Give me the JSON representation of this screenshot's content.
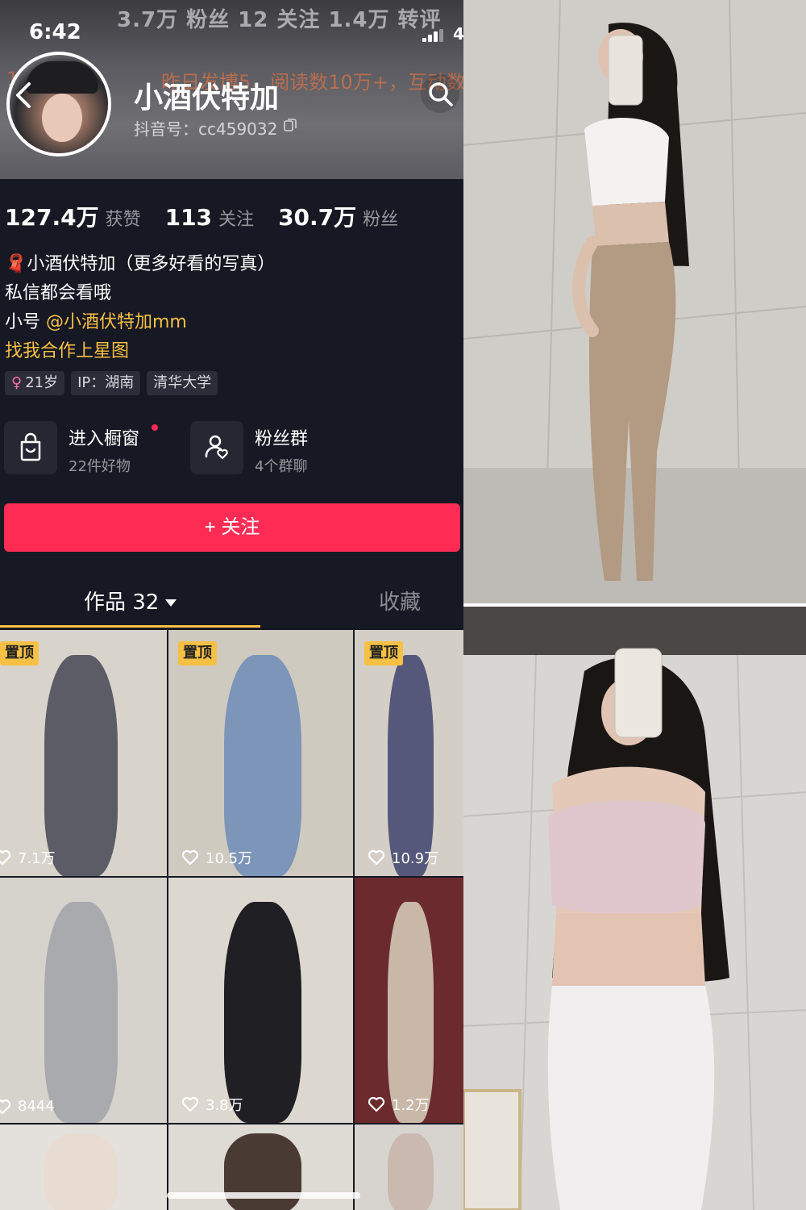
{
  "status_bar": {
    "time": "6:42",
    "battery": "4"
  },
  "header": {
    "ghost_stats": "3.7万 粉丝   12 关注   1.4万 转评",
    "ghost_bio": "昨日发博5，阅读数10万+，互动数",
    "ghost_left": "1.7",
    "name": "小酒伏特加",
    "douyin_id": "抖音号：cc459032"
  },
  "stats": [
    {
      "num": "127.4万",
      "label": "获赞"
    },
    {
      "num": "113",
      "label": "关注"
    },
    {
      "num": "30.7万",
      "label": "粉丝"
    }
  ],
  "bio": {
    "line1": "🧣小酒伏特加（更多好看的写真）",
    "line2": "私信都会看哦",
    "line3_prefix": "小号 ",
    "line3_link": "@小酒伏特加mm",
    "line4": "找我合作上星图"
  },
  "tags": {
    "age": "21岁",
    "age_symbol": "♀",
    "ip": "IP：湖南",
    "school": "清华大学"
  },
  "features": {
    "shop_title": "进入橱窗",
    "shop_sub": "22件好物",
    "group_title": "粉丝群",
    "group_sub": "4个群聊"
  },
  "follow_button": "+ 关注",
  "tabs": {
    "works": "作品 32",
    "favorites": "收藏"
  },
  "videos": [
    {
      "pinned": "置顶",
      "likes": "7.1万",
      "colors": [
        "#d8d4cc",
        "#5c5c66"
      ]
    },
    {
      "pinned": "置顶",
      "likes": "10.5万",
      "colors": [
        "#cfcac0",
        "#7c95b8"
      ]
    },
    {
      "pinned": "置顶",
      "likes": "10.9万",
      "colors": [
        "#d4cfc6",
        "#55587a"
      ]
    },
    {
      "pinned": "",
      "likes": "8444",
      "colors": [
        "#d6d3cd",
        "#a9aaae"
      ]
    },
    {
      "pinned": "",
      "likes": "3.8万",
      "colors": [
        "#dcd8d0",
        "#1f1f24"
      ]
    },
    {
      "pinned": "",
      "likes": "1.2万",
      "colors": [
        "#6a2a2e",
        "#c9b7a8"
      ]
    },
    {
      "pinned": "",
      "likes": "",
      "colors": [
        "#e4e1dc",
        "#e8dcd2"
      ]
    },
    {
      "pinned": "",
      "likes": "",
      "colors": [
        "#dedad4",
        "#4a3a34"
      ]
    },
    {
      "pinned": "",
      "likes": "",
      "colors": [
        "#d7d4cf",
        "#c9b9ae"
      ]
    }
  ]
}
